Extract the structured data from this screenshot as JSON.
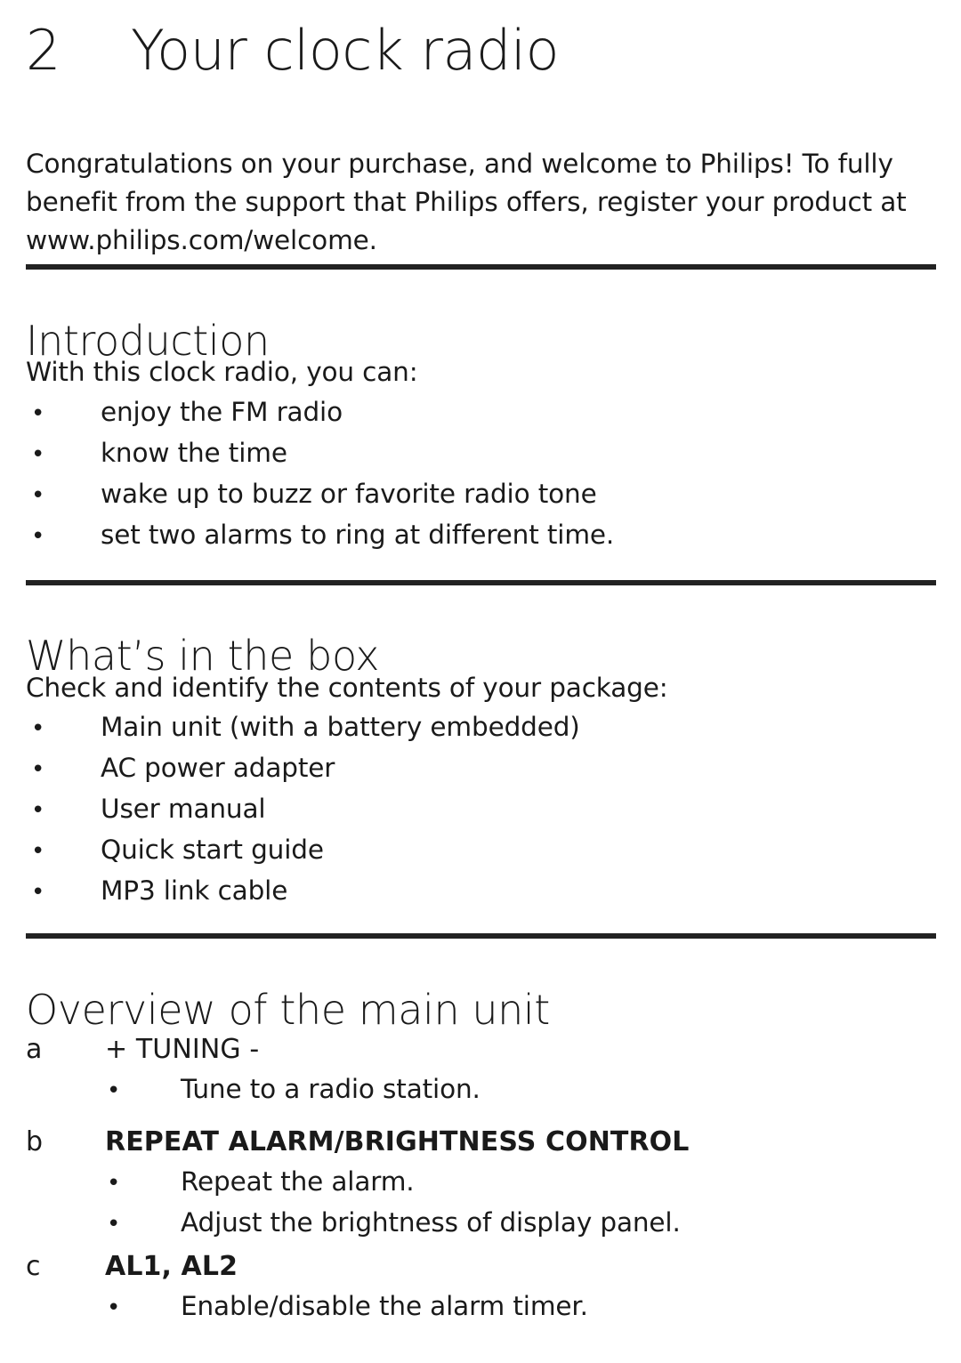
{
  "document": {
    "chapter_number": "2",
    "chapter_title": "Your clock radio",
    "intro_paragraph": "Congratulations on your purchase, and welcome to Philips! To fully benefit from the support that Philips offers, register your product at www.philips.com/welcome.",
    "bullet_glyph": "•",
    "text_color": "#1a1a1a",
    "rule_color": "#222222",
    "background_color": "#ffffff"
  },
  "sections": {
    "introduction": {
      "heading": "Introduction",
      "lead": "With this clock radio, you can:",
      "items": [
        "enjoy the FM radio",
        "know the time",
        "wake up to buzz or favorite radio tone",
        "set two alarms to ring at different time."
      ]
    },
    "whats_in_the_box": {
      "heading": "What’s in the box",
      "lead": "Check and identify the contents of your package:",
      "items": [
        "Main unit (with a battery embedded)",
        "AC power adapter",
        "User manual",
        "Quick start guide",
        "MP3 link cable"
      ]
    },
    "overview": {
      "heading": "Overview of the main unit",
      "entries": [
        {
          "letter": "a",
          "label": "+ TUNING -",
          "bold": false,
          "items": [
            "Tune to a radio station."
          ]
        },
        {
          "letter": "b",
          "label": "REPEAT ALARM/BRIGHTNESS CONTROL",
          "bold": true,
          "items": [
            "Repeat the alarm.",
            "Adjust the brightness of display panel."
          ]
        },
        {
          "letter": "c",
          "label": "AL1, AL2",
          "bold": true,
          "items": [
            "Enable/disable the alarm timer."
          ]
        }
      ]
    }
  }
}
